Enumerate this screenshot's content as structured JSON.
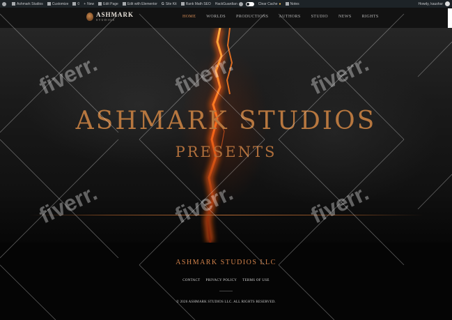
{
  "admin_bar": {
    "items": [
      {
        "icon": "wordpress-icon",
        "label": ""
      },
      {
        "icon": "home-icon",
        "label": "Ashmark Studios"
      },
      {
        "icon": "brush-icon",
        "label": "Customize"
      },
      {
        "icon": "comment-icon",
        "label": "0"
      },
      {
        "icon": "plus-icon",
        "label": "New"
      },
      {
        "icon": "pencil-icon",
        "label": "Edit Page"
      },
      {
        "icon": "elementor-icon",
        "label": "Edit with Elementor"
      },
      {
        "icon": "google-icon",
        "label": "Site Kit"
      },
      {
        "icon": "chart-icon",
        "label": "Rank Math SEO"
      },
      {
        "icon": "",
        "label": "HackGuardian"
      },
      {
        "icon": "",
        "label": "Clear Cache"
      },
      {
        "icon": "",
        "label": "Notes"
      }
    ],
    "greeting": "Howdy, kaushar"
  },
  "header": {
    "logo_name": "ASHMARK",
    "logo_sub": "STUDIOS",
    "nav": [
      {
        "label": "HOME",
        "active": true
      },
      {
        "label": "WORLDS",
        "active": false
      },
      {
        "label": "PRODUCTIONS",
        "active": false
      },
      {
        "label": "AUTHORS",
        "active": false
      },
      {
        "label": "STUDIO",
        "active": false
      },
      {
        "label": "NEWS",
        "active": false
      },
      {
        "label": "RIGHTS",
        "active": false
      }
    ]
  },
  "hero": {
    "title": "ASHMARK STUDIOS",
    "subtitle": "PRESENTS"
  },
  "footer": {
    "brand": "ASHMARK STUDIOS LLC",
    "links": [
      "CONTACT",
      "PRIVACY POLICY",
      "TERMS OF USE"
    ],
    "copyright": "© 2026 ASHMARK STUDIOS LLC. ALL RIGHTS RESERVED."
  },
  "watermark": {
    "text": "fiverr."
  },
  "colors": {
    "accent": "#d88e57",
    "admin_bar": "#1d2327",
    "header_bg": "#121212",
    "title": "#b7773f"
  }
}
